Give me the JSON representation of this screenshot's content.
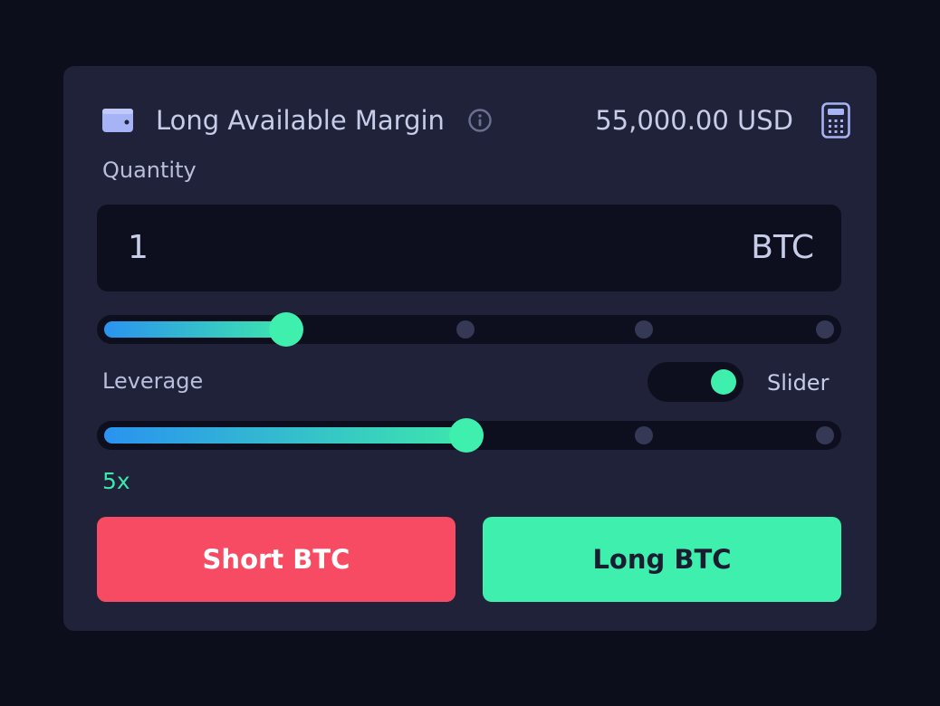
{
  "header": {
    "margin_label": "Long Available Margin",
    "margin_value": "55,000.00 USD",
    "icons": [
      "wallet-icon",
      "info-icon",
      "calculator-icon"
    ]
  },
  "quantity": {
    "label": "Quantity",
    "value": "1",
    "unit": "BTC",
    "slider_fraction": 0.25
  },
  "leverage": {
    "label": "Leverage",
    "toggle_label": "Slider",
    "toggle_on": true,
    "value_label": "5x",
    "slider_fraction": 0.5
  },
  "actions": {
    "short_label": "Short BTC",
    "long_label": "Long BTC"
  },
  "colors": {
    "background": "#0c0e1b",
    "panel": "#1f2239",
    "accent_green": "#3eefae",
    "accent_blue": "#2a93f0",
    "short_red": "#f64b62"
  }
}
